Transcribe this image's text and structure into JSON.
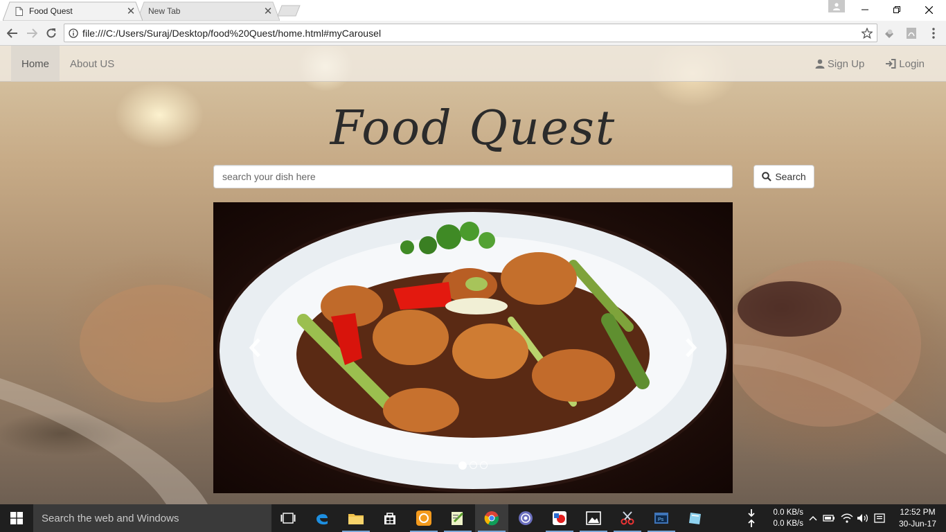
{
  "browser": {
    "tabs": [
      {
        "title": "Food Quest",
        "active": true
      },
      {
        "title": "New Tab",
        "active": false
      }
    ],
    "url": "file:///C:/Users/Suraj/Desktop/food%20Quest/home.html#myCarousel"
  },
  "nav": {
    "left": [
      {
        "label": "Home",
        "active": true
      },
      {
        "label": "About US",
        "active": false
      }
    ],
    "signup_label": "Sign Up",
    "login_label": "Login"
  },
  "hero": {
    "title": "Food Quest",
    "search_placeholder": "search your dish here",
    "search_button": "Search"
  },
  "carousel": {
    "slide_count": 3,
    "active_index": 0
  },
  "taskbar": {
    "search_placeholder": "Search the web and Windows",
    "net_down": "0.0 KB/s",
    "net_up": "0.0 KB/s",
    "time": "12:52 PM",
    "date": "30-Jun-17",
    "apps": [
      "task-view",
      "edge",
      "file-explorer",
      "store",
      "uc-browser",
      "notepad-plus",
      "chrome",
      "media-player",
      "paint",
      "photos",
      "snipping",
      "photoshop",
      "app"
    ]
  }
}
